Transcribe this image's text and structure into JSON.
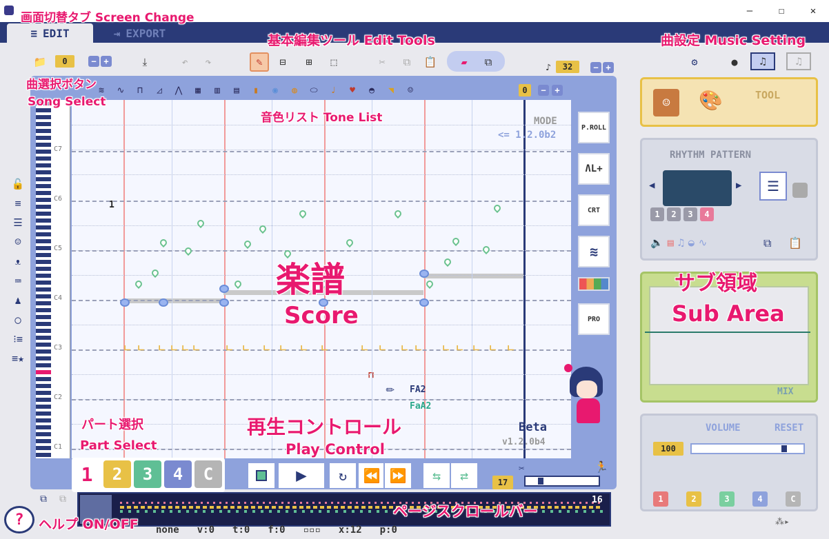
{
  "window": {
    "minimize": "—",
    "maximize": "☐",
    "close": "✕"
  },
  "tabs": [
    {
      "label": "EDIT",
      "icon": "≡"
    },
    {
      "label": "EXPORT",
      "icon": "⇥"
    }
  ],
  "toolbar": {
    "song_number": "0",
    "note_length": "32",
    "pm_minus": "−",
    "pm_plus": "+"
  },
  "tone_list": {
    "selected": "0"
  },
  "score": {
    "octave_labels": [
      "C7",
      "C6",
      "C5",
      "C4",
      "C3",
      "C2",
      "C1"
    ],
    "mode_label": "MODE",
    "mode_value": "<= 1.2.0b2",
    "measure_number": "1",
    "note_name_1": "FA2",
    "note_name_2": "FaA2",
    "beta_label": "Beta",
    "version": "v1.2.0b4"
  },
  "side_tools": {
    "paper": "P.ROLL",
    "pulse": "ɅL+",
    "chord": "CRT",
    "pro": "PRO"
  },
  "parts": [
    "1",
    "2",
    "3",
    "4",
    "C"
  ],
  "play": {
    "page_number": "17",
    "total_pages": "16"
  },
  "right": {
    "tool_label": "TOOL",
    "rhythm_title": "RHYTHM PATTERN",
    "rhythm_slots": [
      "1",
      "2",
      "3",
      "4"
    ],
    "mix_label": "MIX",
    "volume_label": "VOLUME",
    "reset_label": "RESET",
    "volume_value": "100",
    "channels": [
      "1",
      "2",
      "3",
      "4",
      "C"
    ]
  },
  "status_bar": {
    "tone": "none",
    "v": "v:0",
    "t": "t:0",
    "f": "f:0",
    "dots": "▫▫▫",
    "x": "x:12",
    "p": "p:0"
  },
  "annotations": {
    "screen_change": "画面切替タブ  Screen Change",
    "edit_tools": "基本編集ツール  Edit Tools",
    "music_setting": "曲設定  Music Setting",
    "song_select_jp": "曲選択ボタン",
    "song_select_en": "Song Select",
    "tone_list": "音色リスト  Tone List",
    "score_jp": "楽譜",
    "score_en": "Score",
    "sub_area_jp": "サブ領域",
    "sub_area_en": "Sub Area",
    "part_select_jp": "パート選択",
    "part_select_en": "Part Select",
    "play_control_jp": "再生コントロール",
    "play_control_en": "Play Control",
    "page_scroll": "ページスクロールバー",
    "help": "ヘルプ ON/OFF"
  },
  "colors": {
    "accent": "#2a3a78",
    "highlight": "#e8196f",
    "yellow": "#e8c146"
  }
}
